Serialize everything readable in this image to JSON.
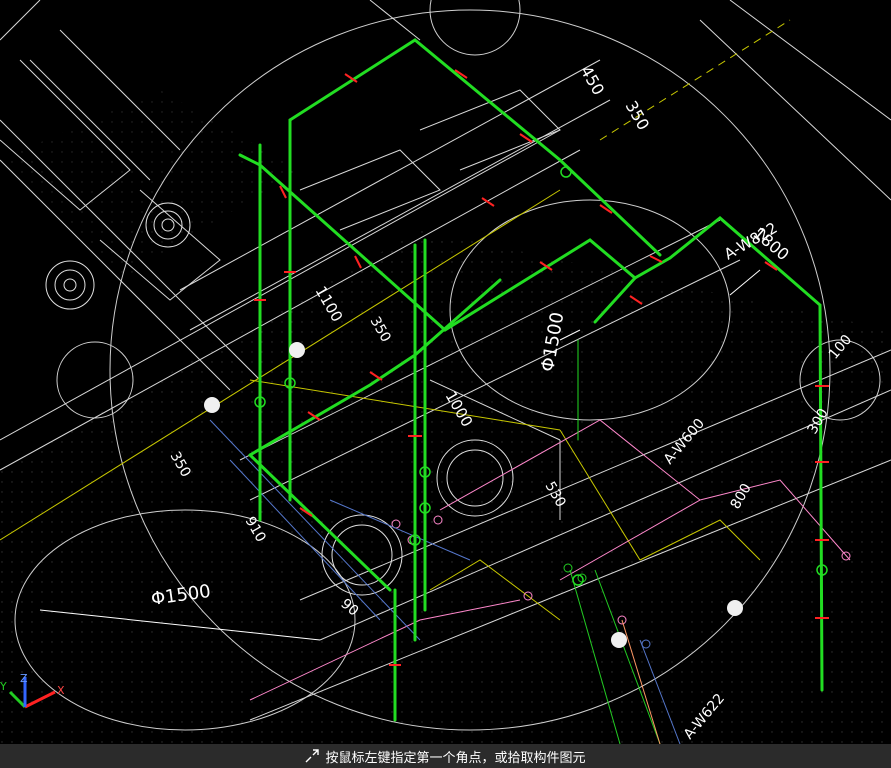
{
  "status": {
    "prompt": "按鼠标左键指定第一个角点，或拾取构件图元"
  },
  "dims": {
    "d450": "450",
    "d350a": "350",
    "d1800": "1800",
    "aw822": "A-W822",
    "d1500": "Φ1500",
    "d1500b": "Φ1500",
    "d1100": "1100",
    "d350b": "350",
    "d350c": "350",
    "d1000": "1000",
    "d300": "300",
    "d100": "100",
    "d530": "530",
    "d800": "800",
    "d910": "910",
    "aw600": "A-W600",
    "aw622": "A-W622",
    "d90": "90"
  },
  "axis_labels": {
    "x": "X",
    "y": "Y",
    "z": "Z"
  },
  "colors": {
    "pipe": "#22dd22",
    "marker": "#ff2222",
    "line": "#e0e0e0",
    "dim": "#ffffff",
    "yellow": "#c8c800",
    "pink": "#ff88cc",
    "blue": "#5577cc"
  }
}
